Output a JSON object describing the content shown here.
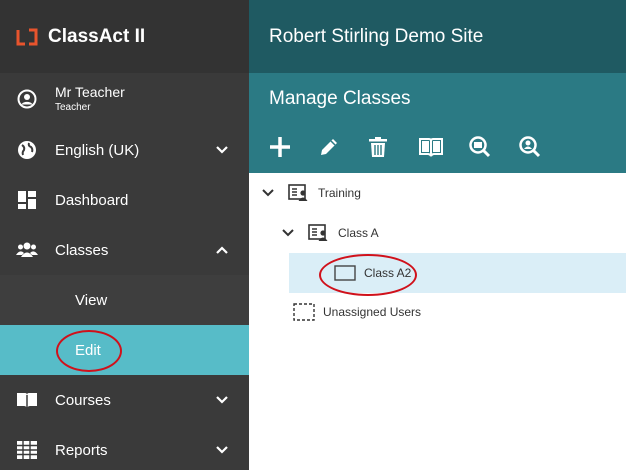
{
  "app": {
    "name_part1": "ClassAct",
    "name_part2": "II",
    "logo_icon": "lj-logo-icon",
    "accent": "#e8542d"
  },
  "user": {
    "name": "Mr Teacher",
    "role": "Teacher",
    "icon": "user-circle-icon"
  },
  "sidebar": {
    "items": [
      {
        "label": "English (UK)",
        "icon": "globe-icon",
        "expand": "chevron-down-icon"
      },
      {
        "label": "Dashboard",
        "icon": "dashboard-icon"
      },
      {
        "label": "Classes",
        "icon": "users-icon",
        "expand": "chevron-up-icon"
      },
      {
        "label": "Courses",
        "icon": "book-icon",
        "expand": "chevron-down-icon"
      },
      {
        "label": "Reports",
        "icon": "table-icon",
        "expand": "chevron-down-icon"
      }
    ],
    "classes_sub": [
      {
        "label": "View",
        "active": false
      },
      {
        "label": "Edit",
        "active": true
      }
    ]
  },
  "header": {
    "site_title": "Robert Stirling Demo Site",
    "page_title": "Manage Classes"
  },
  "toolbar": {
    "tools": [
      "plus-icon",
      "pencil-icon",
      "trash-icon",
      "book-open-icon",
      "search-doc-icon",
      "search-user-icon"
    ]
  },
  "tree": {
    "nodes": [
      {
        "label": "Training",
        "level": 0,
        "expanded": true,
        "icon": "group-card-icon"
      },
      {
        "label": "Class A",
        "level": 1,
        "expanded": true,
        "icon": "group-card-icon"
      },
      {
        "label": "Class A2",
        "level": 2,
        "selected": true,
        "icon": "empty-class-icon"
      },
      {
        "label": "Unassigned Users",
        "level": 0,
        "icon": "dashed-box-icon"
      }
    ]
  },
  "colors": {
    "sidebar": "#3a3a3a",
    "topbar": "#1f5a62",
    "subbar": "#2b7a84",
    "active": "#57bcc8",
    "selected_row": "#daeef7",
    "annotation": "#d0111b"
  }
}
